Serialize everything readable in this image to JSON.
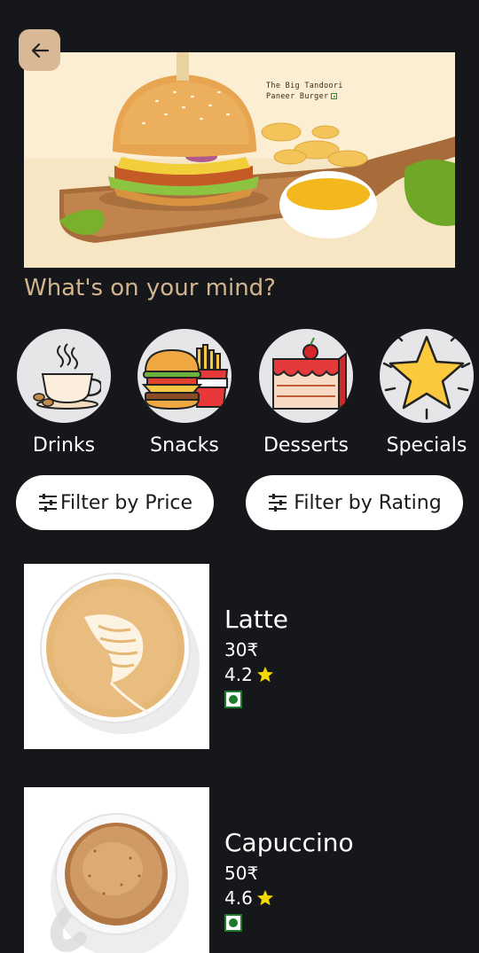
{
  "header": {
    "back_icon": "arrow-left-icon"
  },
  "hero": {
    "caption_line1": "The Big Tandoori",
    "caption_line2": "Paneer Burger"
  },
  "section_title": "What's on your mind?",
  "categories": [
    {
      "label": "Drinks",
      "icon": "coffee-cup-icon"
    },
    {
      "label": "Snacks",
      "icon": "burger-fries-icon"
    },
    {
      "label": "Desserts",
      "icon": "cake-slice-icon"
    },
    {
      "label": "Specials",
      "icon": "star-icon"
    }
  ],
  "filters": {
    "price_label": "Filter by Price",
    "rating_label": "Filter by Rating",
    "icon": "sliders-icon"
  },
  "items": [
    {
      "name": "Latte",
      "price": "30₹",
      "rating": "4.2"
    },
    {
      "name": "Capuccino",
      "price": "50₹",
      "rating": "4.6"
    }
  ],
  "colors": {
    "background": "#15171b",
    "accent": "#d2b48e",
    "veg_green": "#1c7c2c",
    "star": "#f5d800"
  }
}
